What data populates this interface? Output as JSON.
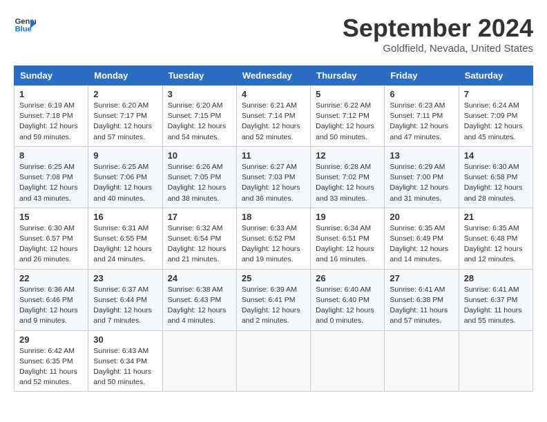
{
  "logo": {
    "line1": "General",
    "line2": "Blue"
  },
  "title": "September 2024",
  "location": "Goldfield, Nevada, United States",
  "weekdays": [
    "Sunday",
    "Monday",
    "Tuesday",
    "Wednesday",
    "Thursday",
    "Friday",
    "Saturday"
  ],
  "weeks": [
    [
      {
        "day": "1",
        "detail": "Sunrise: 6:19 AM\nSunset: 7:18 PM\nDaylight: 12 hours\nand 59 minutes."
      },
      {
        "day": "2",
        "detail": "Sunrise: 6:20 AM\nSunset: 7:17 PM\nDaylight: 12 hours\nand 57 minutes."
      },
      {
        "day": "3",
        "detail": "Sunrise: 6:20 AM\nSunset: 7:15 PM\nDaylight: 12 hours\nand 54 minutes."
      },
      {
        "day": "4",
        "detail": "Sunrise: 6:21 AM\nSunset: 7:14 PM\nDaylight: 12 hours\nand 52 minutes."
      },
      {
        "day": "5",
        "detail": "Sunrise: 6:22 AM\nSunset: 7:12 PM\nDaylight: 12 hours\nand 50 minutes."
      },
      {
        "day": "6",
        "detail": "Sunrise: 6:23 AM\nSunset: 7:11 PM\nDaylight: 12 hours\nand 47 minutes."
      },
      {
        "day": "7",
        "detail": "Sunrise: 6:24 AM\nSunset: 7:09 PM\nDaylight: 12 hours\nand 45 minutes."
      }
    ],
    [
      {
        "day": "8",
        "detail": "Sunrise: 6:25 AM\nSunset: 7:08 PM\nDaylight: 12 hours\nand 43 minutes."
      },
      {
        "day": "9",
        "detail": "Sunrise: 6:25 AM\nSunset: 7:06 PM\nDaylight: 12 hours\nand 40 minutes."
      },
      {
        "day": "10",
        "detail": "Sunrise: 6:26 AM\nSunset: 7:05 PM\nDaylight: 12 hours\nand 38 minutes."
      },
      {
        "day": "11",
        "detail": "Sunrise: 6:27 AM\nSunset: 7:03 PM\nDaylight: 12 hours\nand 36 minutes."
      },
      {
        "day": "12",
        "detail": "Sunrise: 6:28 AM\nSunset: 7:02 PM\nDaylight: 12 hours\nand 33 minutes."
      },
      {
        "day": "13",
        "detail": "Sunrise: 6:29 AM\nSunset: 7:00 PM\nDaylight: 12 hours\nand 31 minutes."
      },
      {
        "day": "14",
        "detail": "Sunrise: 6:30 AM\nSunset: 6:58 PM\nDaylight: 12 hours\nand 28 minutes."
      }
    ],
    [
      {
        "day": "15",
        "detail": "Sunrise: 6:30 AM\nSunset: 6:57 PM\nDaylight: 12 hours\nand 26 minutes."
      },
      {
        "day": "16",
        "detail": "Sunrise: 6:31 AM\nSunset: 6:55 PM\nDaylight: 12 hours\nand 24 minutes."
      },
      {
        "day": "17",
        "detail": "Sunrise: 6:32 AM\nSunset: 6:54 PM\nDaylight: 12 hours\nand 21 minutes."
      },
      {
        "day": "18",
        "detail": "Sunrise: 6:33 AM\nSunset: 6:52 PM\nDaylight: 12 hours\nand 19 minutes."
      },
      {
        "day": "19",
        "detail": "Sunrise: 6:34 AM\nSunset: 6:51 PM\nDaylight: 12 hours\nand 16 minutes."
      },
      {
        "day": "20",
        "detail": "Sunrise: 6:35 AM\nSunset: 6:49 PM\nDaylight: 12 hours\nand 14 minutes."
      },
      {
        "day": "21",
        "detail": "Sunrise: 6:35 AM\nSunset: 6:48 PM\nDaylight: 12 hours\nand 12 minutes."
      }
    ],
    [
      {
        "day": "22",
        "detail": "Sunrise: 6:36 AM\nSunset: 6:46 PM\nDaylight: 12 hours\nand 9 minutes."
      },
      {
        "day": "23",
        "detail": "Sunrise: 6:37 AM\nSunset: 6:44 PM\nDaylight: 12 hours\nand 7 minutes."
      },
      {
        "day": "24",
        "detail": "Sunrise: 6:38 AM\nSunset: 6:43 PM\nDaylight: 12 hours\nand 4 minutes."
      },
      {
        "day": "25",
        "detail": "Sunrise: 6:39 AM\nSunset: 6:41 PM\nDaylight: 12 hours\nand 2 minutes."
      },
      {
        "day": "26",
        "detail": "Sunrise: 6:40 AM\nSunset: 6:40 PM\nDaylight: 12 hours\nand 0 minutes."
      },
      {
        "day": "27",
        "detail": "Sunrise: 6:41 AM\nSunset: 6:38 PM\nDaylight: 11 hours\nand 57 minutes."
      },
      {
        "day": "28",
        "detail": "Sunrise: 6:41 AM\nSunset: 6:37 PM\nDaylight: 11 hours\nand 55 minutes."
      }
    ],
    [
      {
        "day": "29",
        "detail": "Sunrise: 6:42 AM\nSunset: 6:35 PM\nDaylight: 11 hours\nand 52 minutes."
      },
      {
        "day": "30",
        "detail": "Sunrise: 6:43 AM\nSunset: 6:34 PM\nDaylight: 11 hours\nand 50 minutes."
      },
      null,
      null,
      null,
      null,
      null
    ]
  ]
}
